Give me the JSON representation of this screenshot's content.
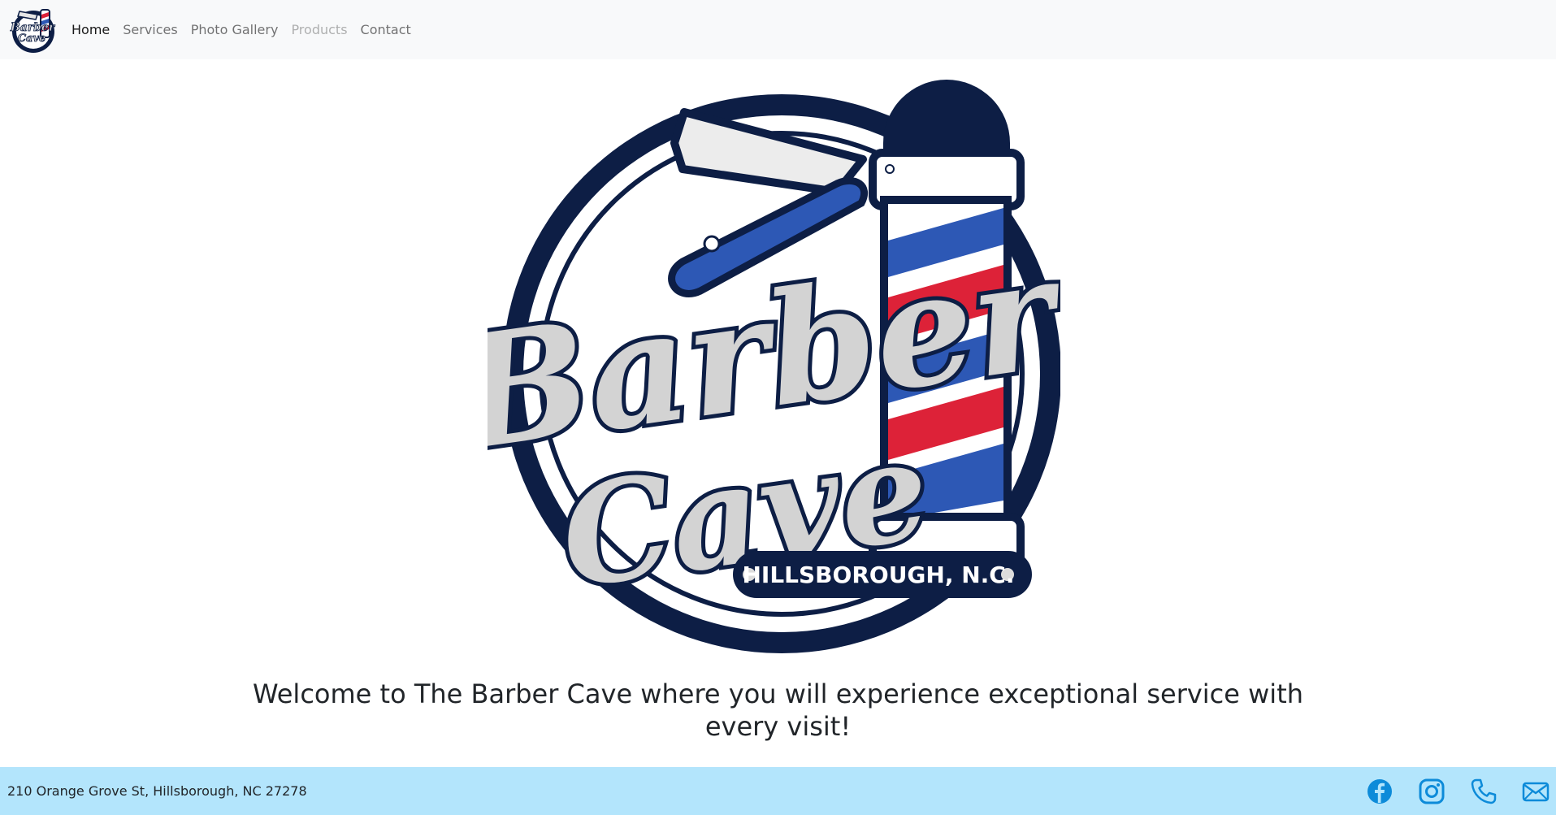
{
  "nav": {
    "logo_text": "Barber Cave",
    "items": [
      {
        "label": "Home",
        "state": "active"
      },
      {
        "label": "Services",
        "state": "normal"
      },
      {
        "label": "Photo Gallery",
        "state": "normal"
      },
      {
        "label": "Products",
        "state": "disabled"
      },
      {
        "label": "Contact",
        "state": "normal"
      }
    ]
  },
  "hero": {
    "logo_line1": "Barber",
    "logo_line2": "Cave",
    "logo_location": "HILLSBOROUGH, N.C.",
    "welcome": "Welcome to The Barber Cave where you will experience exceptional service with every visit!"
  },
  "footer": {
    "address": "210 Orange Grove St, Hillsborough, NC 27278",
    "icons": [
      "facebook-icon",
      "instagram-icon",
      "phone-icon",
      "envelope-icon"
    ]
  },
  "colors": {
    "navy": "#0d1e45",
    "blue": "#2d58b5",
    "red": "#dd2238",
    "footer_bg": "#b3e5fc",
    "nav_bg": "#f8f9fa",
    "icon_blue": "#0d8bd9"
  }
}
